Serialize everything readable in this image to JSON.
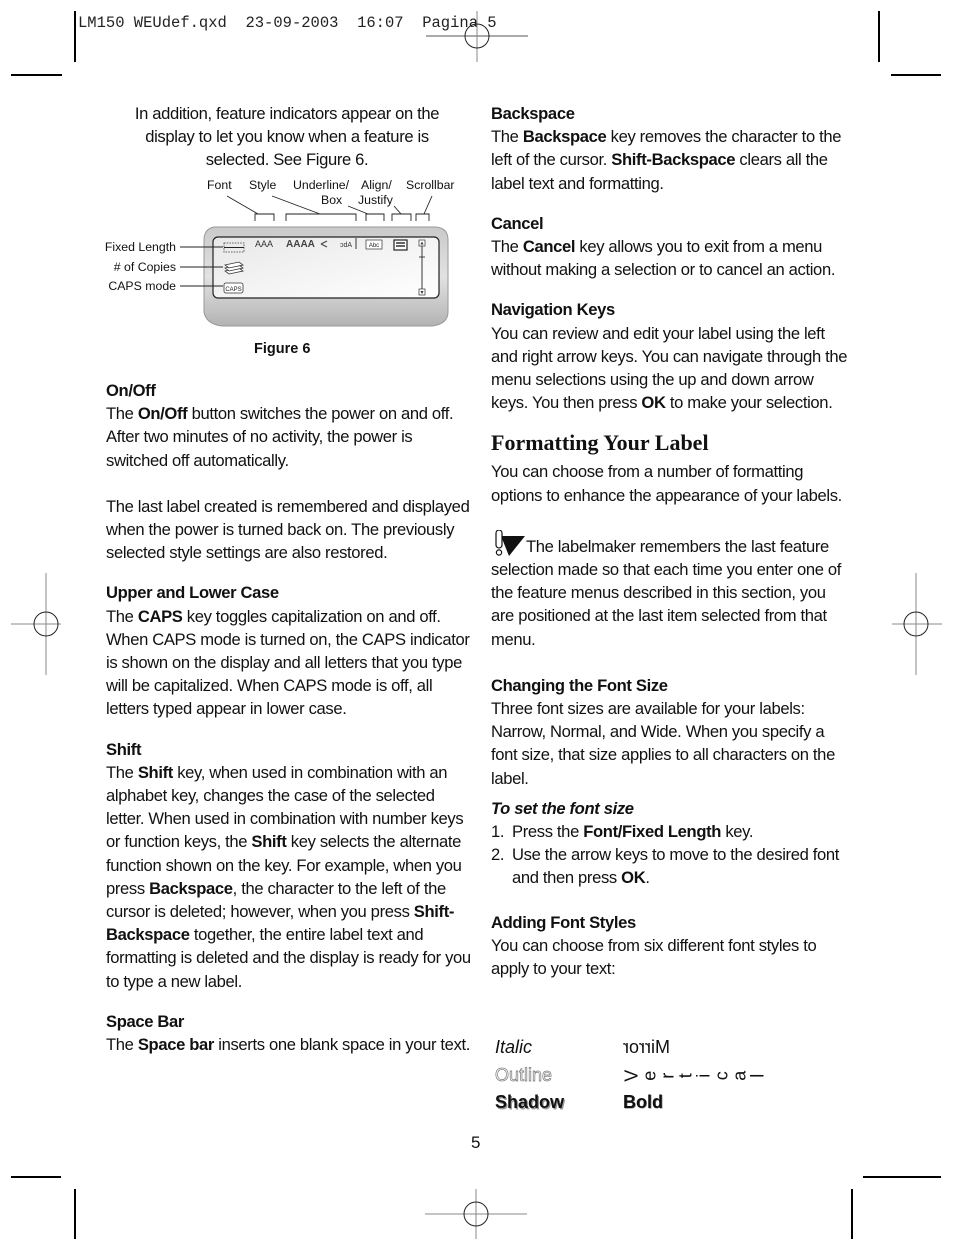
{
  "slug": {
    "filename": "LM150 WEUdef.qxd",
    "date": "23-09-2003",
    "time": "16:07",
    "page": "Pagina 5"
  },
  "intro": "In addition, feature indicators appear on the display to let you know when a feature is selected. See Figure 6.",
  "figure": {
    "caption": "Figure 6",
    "top_labels": [
      "Font",
      "Style",
      "Underline/",
      "Box",
      "Align/",
      "Justify",
      "Scrollbar"
    ],
    "left_labels": [
      "Fixed Length",
      "# of Copies",
      "CAPS mode"
    ],
    "display_icons": {
      "font": "AAA",
      "style": "AAAA",
      "mirror": "ɔdA",
      "underline_box": "Abc",
      "caps": "CAPS"
    }
  },
  "left_column": [
    {
      "heading": "On/Off",
      "paragraphs": [
        [
          {
            "t": "The "
          },
          {
            "b": "On/Off"
          },
          {
            "t": " button switches the power on and off. After two minutes of no activity, the power is switched off automatically."
          }
        ],
        [
          {
            "t": "The last label created is remembered and displayed when the power is turned back on. The previously selected style settings are also restored."
          }
        ]
      ]
    },
    {
      "heading": "Upper and Lower Case",
      "paragraphs": [
        [
          {
            "t": "The "
          },
          {
            "b": "CAPS"
          },
          {
            "t": " key toggles capitalization on and off. When CAPS mode is turned on, the CAPS indicator is shown on the display and all letters that you type will be capitalized. When CAPS mode is off, all letters typed appear in lower case."
          }
        ]
      ]
    },
    {
      "heading": "Shift",
      "paragraphs": [
        [
          {
            "t": "The "
          },
          {
            "b": "Shift"
          },
          {
            "t": " key, when used in combination with an alphabet key, changes the case of the selected letter. When used in combination with number keys or function keys, the "
          },
          {
            "b": "Shift"
          },
          {
            "t": " key selects the alternate function shown on the key. For example, when you press "
          },
          {
            "b": "Backspace"
          },
          {
            "t": ", the character to the left of the cursor is deleted; however, when you press "
          },
          {
            "b": "Shift-Backspace"
          },
          {
            "t": " together, the entire label text and formatting is deleted and the display is ready for you to type a new label."
          }
        ]
      ]
    },
    {
      "heading": "Space Bar",
      "paragraphs": [
        [
          {
            "t": "The "
          },
          {
            "b": "Space bar"
          },
          {
            "t": " inserts one blank space in your text."
          }
        ]
      ]
    }
  ],
  "right_column": {
    "sections": [
      {
        "heading": "Backspace",
        "paragraphs": [
          [
            {
              "t": "The "
            },
            {
              "b": "Backspace"
            },
            {
              "t": " key removes the character to the left of the cursor. "
            },
            {
              "b": "Shift-Backspace"
            },
            {
              "t": " clears all the label text and formatting."
            }
          ]
        ]
      },
      {
        "heading": "Cancel",
        "paragraphs": [
          [
            {
              "t": "The "
            },
            {
              "b": "Cancel"
            },
            {
              "t": " key allows you to exit from a menu without making a selection or to cancel an action."
            }
          ]
        ]
      },
      {
        "heading": "Navigation Keys",
        "paragraphs": [
          [
            {
              "t": "You can review and edit your label using the left and right arrow keys. You can navigate through the menu selections using the up and down arrow keys. You then press "
            },
            {
              "b": "OK"
            },
            {
              "t": " to make your selection."
            }
          ]
        ]
      }
    ],
    "formatting_title": "Formatting Your Label",
    "formatting_intro": "You can choose from a number of formatting options to enhance the appearance of your labels.",
    "note": "The labelmaker remembers the last feature selection made so that each time you enter one of the feature menus described in this section, you are positioned at the last item selected from that menu.",
    "font_size": {
      "heading": "Changing the Font Size",
      "text": "Three font sizes are available for your labels: Narrow, Normal, and Wide. When you specify a font size, that size applies to all characters on the label.",
      "procedure_title": "To set the font size",
      "steps": [
        [
          {
            "t": "Press the "
          },
          {
            "b": "Font/Fixed Length"
          },
          {
            "t": " key."
          }
        ],
        [
          {
            "t": "Use the arrow keys to move to the desired font and then press "
          },
          {
            "b": "OK"
          },
          {
            "t": "."
          }
        ]
      ]
    },
    "font_styles": {
      "heading": "Adding Font Styles",
      "text": "You can choose from six different font styles to apply to your text:",
      "samples": [
        "Italic",
        "Mirror",
        "Outline",
        "Vertical",
        "Shadow",
        "Bold"
      ]
    }
  },
  "page_number": "5"
}
